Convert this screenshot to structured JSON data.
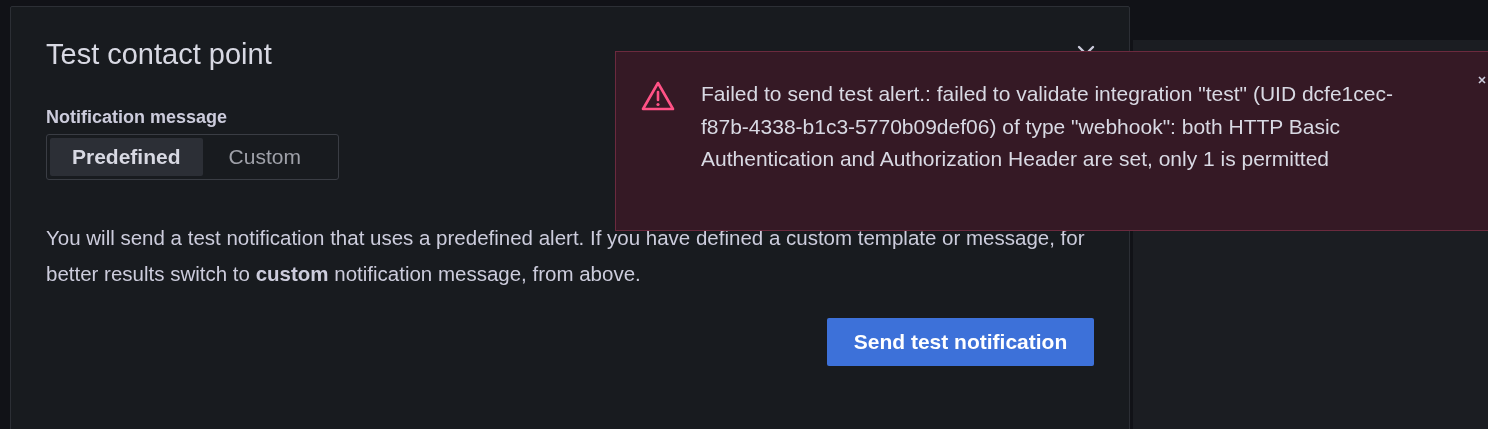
{
  "modal": {
    "title": "Test contact point",
    "field_label": "Notification message",
    "options": [
      {
        "label": "Predefined",
        "selected": true
      },
      {
        "label": "Custom",
        "selected": false
      }
    ],
    "description": "You will send a test notification that uses a predefined alert. If you have defined a custom template or message, for better results switch to **custom** notification message, from above.",
    "button": "Send test notification"
  },
  "toast": {
    "message": "Failed to send test alert.: failed to validate integration \"test\" (UID dcfe1cec-f87b-4338-b1c3-5770b09def06) of type \"webhook\": both HTTP Basic Authentication and Authorization Header are set, only 1 is permitted"
  }
}
